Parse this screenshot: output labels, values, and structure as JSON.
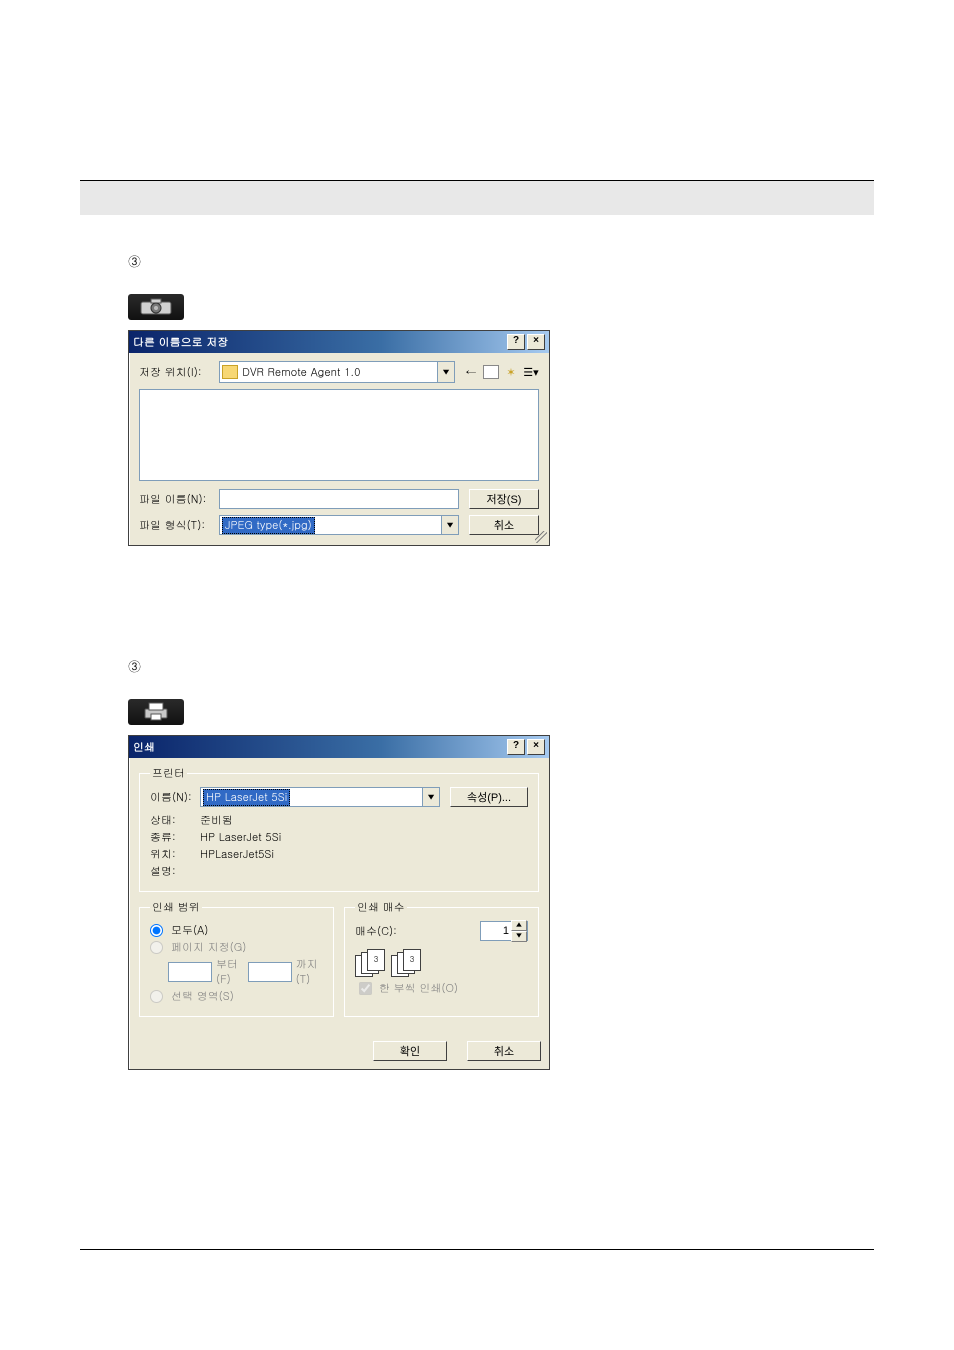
{
  "markers": {
    "three": "③"
  },
  "saveAs": {
    "title": "다른 이름으로 저장",
    "locationLabel": "저장 위치(I):",
    "locationValue": "DVR Remote Agent 1.0",
    "fileNameLabel": "파일 이름(N):",
    "fileNameValue": "",
    "fileTypeLabel": "파일 형식(T):",
    "fileTypeValue": "JPEG type(*.jpg)",
    "saveBtn": "저장(S)",
    "cancelBtn": "취소"
  },
  "print": {
    "title": "인쇄",
    "printerLegend": "프린터",
    "nameLabel": "이름(N):",
    "nameValue": "HP LaserJet 5Si",
    "propsBtn": "속성(P)...",
    "statusLabel": "상태:",
    "statusValue": "준비됨",
    "typeLabel": "종류:",
    "typeValue": "HP LaserJet 5Si",
    "whereLabel": "위치:",
    "whereValue": "HPLaserJet5Si",
    "commentLabel": "설명:",
    "commentValue": "",
    "rangeLegend": "인쇄 범위",
    "rangeAll": "모두(A)",
    "rangePages": "페이지 지정(G)",
    "rangeFrom": "부터(F)",
    "rangeTo": "까지(T)",
    "rangeSelection": "선택 영역(S)",
    "copiesLegend": "인쇄 매수",
    "copiesLabel": "매수(C):",
    "copiesValue": "1",
    "collateLabel": "한 부씩 인쇄(O)",
    "okBtn": "확인",
    "cancelBtn": "취소"
  }
}
